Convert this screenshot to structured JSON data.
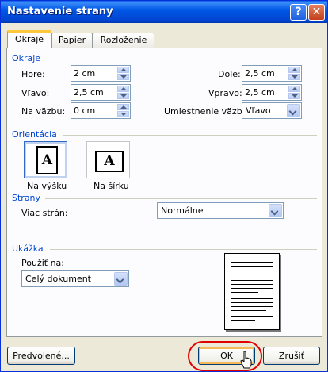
{
  "window": {
    "title": "Nastavenie strany"
  },
  "tabs": [
    {
      "label": "Okraje",
      "active": true
    },
    {
      "label": "Papier",
      "active": false
    },
    {
      "label": "Rozloženie",
      "active": false
    }
  ],
  "margins": {
    "section_title": "Okraje",
    "top_label": "Hore:",
    "top_value": "2 cm",
    "bottom_label": "Dole:",
    "bottom_value": "2,5 cm",
    "left_label": "Vľavo:",
    "left_value": "2,5 cm",
    "right_label": "Vpravo:",
    "right_value": "2,5 cm",
    "gutter_label": "Na väzbu:",
    "gutter_value": "0 cm",
    "gutter_pos_label": "Umiestnenie väzby:",
    "gutter_pos_value": "Vľavo"
  },
  "orientation": {
    "section_title": "Orientácia",
    "portrait_label": "Na výšku",
    "landscape_label": "Na šírku",
    "icon_glyph": "A",
    "selected": "portrait"
  },
  "pages": {
    "section_title": "Strany",
    "multiple_label": "Viac strán:",
    "multiple_value": "Normálne"
  },
  "preview": {
    "section_title": "Ukážka",
    "apply_label": "Použiť na:",
    "apply_value": "Celý dokument"
  },
  "buttons": {
    "default_label": "Predvolené...",
    "ok_label": "OK",
    "cancel_label": "Zrušiť"
  },
  "titlebar_buttons": {
    "help": "?",
    "close": "✕"
  },
  "colors": {
    "accent": "#0046d5",
    "highlight_ring": "#e00000",
    "title_bar": "#0058e6"
  }
}
